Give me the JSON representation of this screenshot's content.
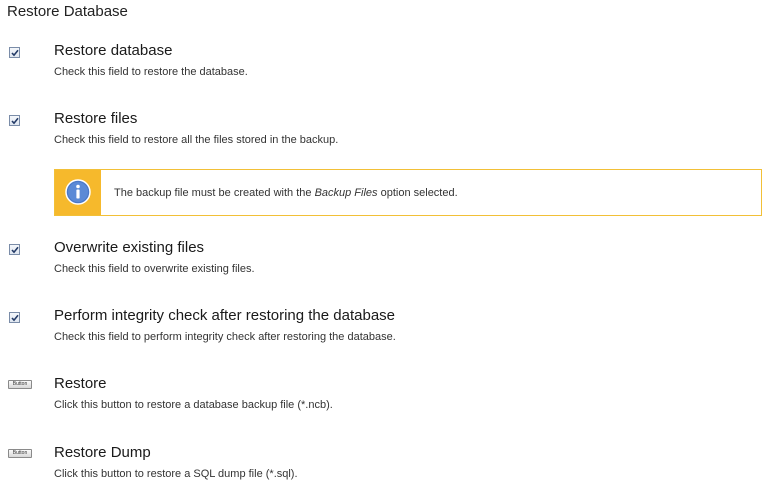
{
  "page": {
    "title": "Restore Database"
  },
  "options": [
    {
      "title": "Restore database",
      "description": "Check this field to restore the database.",
      "checked": true
    },
    {
      "title": "Restore files",
      "description": "Check this field to restore all the files stored in the backup.",
      "checked": true
    },
    {
      "title": "Overwrite existing files",
      "description": "Check this field to overwrite existing files.",
      "checked": true
    },
    {
      "title": "Perform integrity check after restoring the database",
      "description": "Check this field to perform integrity check after restoring the database.",
      "checked": true
    }
  ],
  "buttons": [
    {
      "icon_label": "Button",
      "title": "Restore",
      "description": "Click this button to restore a database backup file (*.ncb)."
    },
    {
      "icon_label": "Button",
      "title": "Restore Dump",
      "description": "Click this button to restore a SQL dump file (*.sql)."
    }
  ],
  "info": {
    "icon": "info-icon",
    "text_before": "The backup file must be created with the ",
    "text_emphasis": "Backup Files",
    "text_after": " option selected.",
    "accent_color": "#f6b92c",
    "border_color": "#f2c037"
  }
}
